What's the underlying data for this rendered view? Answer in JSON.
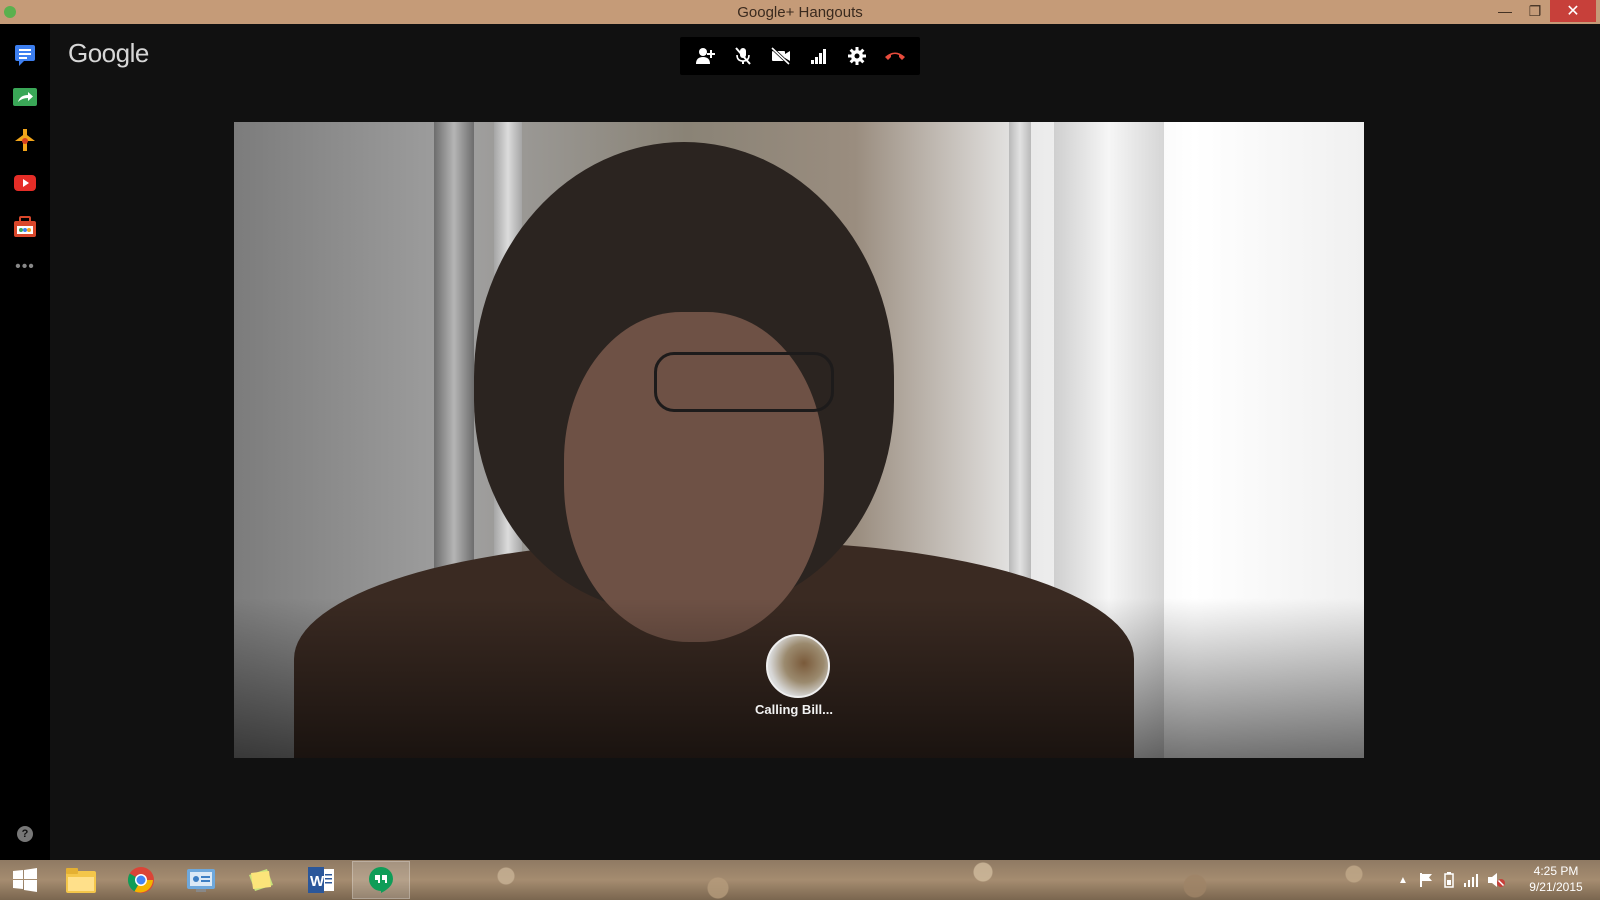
{
  "window": {
    "title": "Google+ Hangouts",
    "minimize": "—",
    "maximize": "❐",
    "close": "✕"
  },
  "rail": {
    "items": [
      {
        "name": "chat",
        "icon": "chat-icon",
        "color": "#3d7ff0"
      },
      {
        "name": "share",
        "icon": "share-arrow-icon",
        "color": "#3aa757"
      },
      {
        "name": "remote",
        "icon": "remote-desktop-icon",
        "color": "#f2a51a"
      },
      {
        "name": "youtube",
        "icon": "youtube-icon",
        "color": "#e52d27"
      },
      {
        "name": "toolbox",
        "icon": "toolbox-icon",
        "color": "#d9472b"
      }
    ],
    "more": "•••",
    "help": "?"
  },
  "main": {
    "logo": "Google",
    "toolbar": [
      {
        "icon": "add-person-icon"
      },
      {
        "icon": "mic-muted-icon"
      },
      {
        "icon": "camera-off-icon"
      },
      {
        "icon": "signal-bars-icon"
      },
      {
        "icon": "gear-icon"
      },
      {
        "icon": "hang-up-icon",
        "color": "#e84c3d"
      }
    ],
    "call": {
      "status": "Calling Bill..."
    }
  },
  "taskbar": {
    "apps": [
      {
        "icon": "windows-start-icon"
      },
      {
        "icon": "file-explorer-icon"
      },
      {
        "icon": "chrome-icon"
      },
      {
        "icon": "control-panel-icon"
      },
      {
        "icon": "sticky-notes-icon"
      },
      {
        "icon": "word-icon"
      },
      {
        "icon": "hangouts-icon",
        "active": true
      }
    ],
    "clock": {
      "time": "4:25 PM",
      "date": "9/21/2015"
    }
  }
}
